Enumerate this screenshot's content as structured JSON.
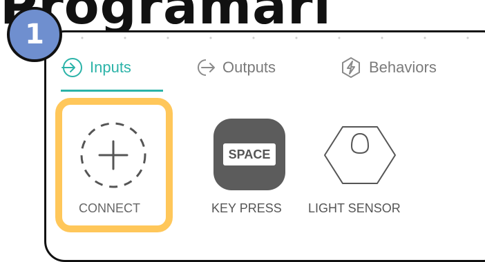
{
  "heading": {
    "text": "Programari"
  },
  "step_badge": {
    "number": "1"
  },
  "tabs": [
    {
      "label": "Inputs",
      "active": true,
      "icon": "input-arrow-icon"
    },
    {
      "label": "Outputs",
      "active": false,
      "icon": "output-arrow-icon"
    },
    {
      "label": "Behaviors",
      "active": false,
      "icon": "lightning-bolt-icon"
    }
  ],
  "items": [
    {
      "label": "CONNECT",
      "icon": "dashed-plus-icon",
      "highlighted": true
    },
    {
      "label": "KEY PRESS",
      "icon": "keycap-icon",
      "key_text": "SPACE"
    },
    {
      "label": "LIGHT SENSOR",
      "icon": "light-sensor-icon"
    }
  ],
  "colors": {
    "accent": "#2bb3a8",
    "highlight": "#ffc75a",
    "badge": "#6f8fcf",
    "keycap": "#5c5c5c"
  }
}
